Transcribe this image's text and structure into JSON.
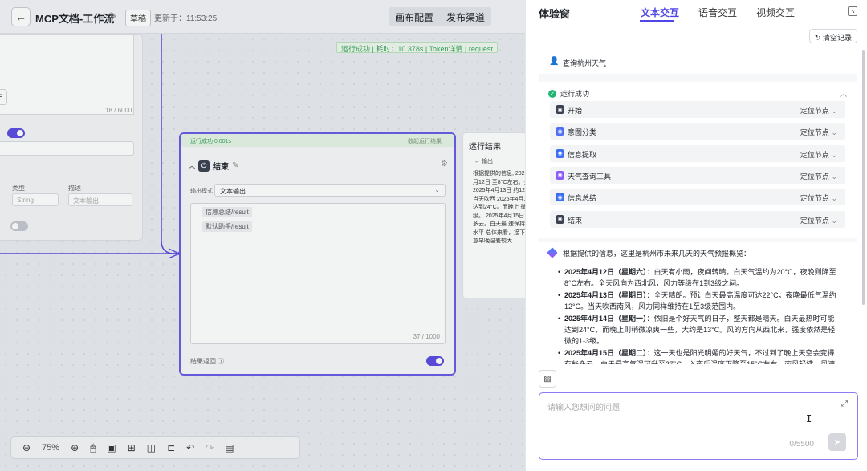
{
  "header": {
    "back_icon": "arrow-left-icon",
    "title": "MCP文档-工作流",
    "draft": "草稿",
    "updated": "更新于：11:53:25",
    "btn_canvas": "画布配置",
    "btn_publish": "发布渠道"
  },
  "left_panel": {
    "count": "18 / 6000",
    "col_type": "类型",
    "col_desc": "描述",
    "type_value": "String",
    "desc_placeholder": "文本输出"
  },
  "run_bar": "运行成功 | 耗时：10.378s  |  Token详情  |  request",
  "end_node": {
    "status": "运行成功 0.001s",
    "status_right": "收起运行结果",
    "title": "结束",
    "mode_label": "输出模式",
    "mode_value": "文本输出",
    "vars": [
      "信息总结/result",
      "默认助手/result"
    ],
    "count": "37 / 1000",
    "footer": "结果返回"
  },
  "run_panel": {
    "title": "运行结果",
    "sub": "← 输出",
    "body": "根据提供的信息, 2025年4月12日 至8°C左右。全天 2025年4月13日 约12°C。当天吹西 2025年4月14日 达到24°C。而晚上 微的1-3级。 2025年4月15日 有些多云。白天最 速保持在较低水平 总体来看，接下来 注意早晚温差较大"
  },
  "toolbar": {
    "zoom": "75%"
  },
  "chat": {
    "title": "体验窗",
    "tabs": [
      "文本交互",
      "语音交互",
      "视频交互"
    ],
    "clear": "清空记录",
    "question": "查询杭州天气",
    "run_status": "运行成功",
    "steps": [
      {
        "name": "开始",
        "loc": "定位节点",
        "color": "#3b4150"
      },
      {
        "name": "意图分类",
        "loc": "定位节点",
        "color": "#4f6ef7"
      },
      {
        "name": "信息提取",
        "loc": "定位节点",
        "color": "#3b6ef5"
      },
      {
        "name": "天气查询工具",
        "loc": "定位节点",
        "color": "#8b5cf6"
      },
      {
        "name": "信息总结",
        "loc": "定位节点",
        "color": "#3b6ef5"
      },
      {
        "name": "结束",
        "loc": "定位节点",
        "color": "#3b4150"
      }
    ],
    "answer_intro": "根据提供的信息，这里是杭州市未来几天的天气预报概览：",
    "answer_items": [
      {
        "date": "2025年4月12日（星期六）",
        "text": "：白天有小雨，夜间转晴。白天气温约为20°C，夜晚则降至8°C左右。全天风向为西北风，风力等级在1到3级之间。"
      },
      {
        "date": "2025年4月13日（星期日）",
        "text": "：全天晴朗。预计白天最高温度可达22°C，夜晚最低气温约12°C。当天吹西南风，风力同样维持在1至3级范围内。"
      },
      {
        "date": "2025年4月14日（星期一）",
        "text": "：依旧是个好天气的日子，整天都是晴天。白天最热时可能达到24°C，而晚上则稍微凉爽一些，大约是13°C。风的方向从西北来，强度依然是轻微的1-3级。"
      },
      {
        "date": "2025年4月15日（星期二）",
        "text": "：这一天也是阳光明媚的好天气，不过到了晚上天空会变得有些多云。白天最高气温可升至27°C，入夜后温度下降至15°C左右。南风轻拂，风速保持"
      }
    ],
    "input_placeholder": "请输入您想问的问题",
    "input_count": "0/5500"
  }
}
